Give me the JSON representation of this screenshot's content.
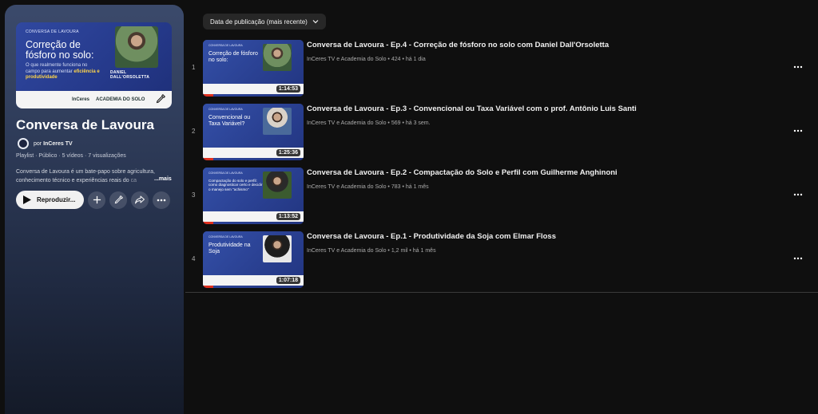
{
  "playlist": {
    "cover": {
      "brand": "CONVERSA DE LAVOURA",
      "title": "Correção de fósforo no solo:",
      "subtitle_pre": "O que realmente funciona no campo para aumentar ",
      "subtitle_bold": "eficiência e produtividade",
      "guest": "DANIEL DALL'ORSOLETTA",
      "footer_left": "InCeres",
      "footer_right": "ACADEMIA DO SOLO"
    },
    "title": "Conversa de Lavoura",
    "owner_prefix": "por",
    "owner": "InCeres TV",
    "meta": "Playlist · Público · 5 vídeos · 7 visualizações",
    "description": "Conversa de Lavoura é um bate-papo sobre agricultura, conhecimento técnico e experiências reais do",
    "description_fade": "ca",
    "more_label": "...mais",
    "play_label": "Reproduzir..."
  },
  "sort": {
    "label": "Data de publicação (mais recente)"
  },
  "videos": [
    {
      "index": "1",
      "title": "Conversa de Lavoura - Ep.4 - Correção de fósforo no solo com Daniel Dall'Orsoletta",
      "meta": "InCeres TV e Academia do Solo • 424 • há 1 dia",
      "duration": "1:14:53",
      "thumb_brand": "CONVERSA DE LAVOURA",
      "thumb_title": "Correção de fósforo no solo:",
      "progress": 0.1
    },
    {
      "index": "2",
      "title": "Conversa de Lavoura - Ep.3 - Convencional ou Taxa Variável com o prof. Antônio Luis Santi",
      "meta": "InCeres TV e Academia do Solo • 569 • há 3 sem.",
      "duration": "1:25:36",
      "thumb_brand": "CONVERSA DE LAVOURA",
      "thumb_title": "Convencional ou Taxa Variável?",
      "progress": 0.1
    },
    {
      "index": "3",
      "title": "Conversa de Lavoura - Ep.2 - Compactação do Solo e Perfil com Guilherme Anghinoni",
      "meta": "InCeres TV e Academia do Solo • 783 • há 1 mês",
      "duration": "1:13:52",
      "thumb_brand": "CONVERSA DE LAVOURA",
      "thumb_title": "Compactação do solo e perfil: como diagnosticar certo e decidir o manejo sem \"achismo\"",
      "progress": 0.1
    },
    {
      "index": "4",
      "title": "Conversa de Lavoura - Ep.1 - Produtividade da Soja com Elmar Floss",
      "meta": "InCeres TV e Academia do Solo • 1,2 mil • há 1 mês",
      "duration": "1:07:18",
      "thumb_brand": "CONVERSA DE LAVOURA",
      "thumb_title": "Produtividade na Soja",
      "progress": 0.1
    }
  ],
  "icons": {
    "play": "play-icon",
    "add": "plus-icon",
    "edit": "pencil-icon",
    "share": "share-icon",
    "more": "more-horiz-icon",
    "sort": "chevron-down-icon",
    "kebab": "more-vert-icon"
  }
}
